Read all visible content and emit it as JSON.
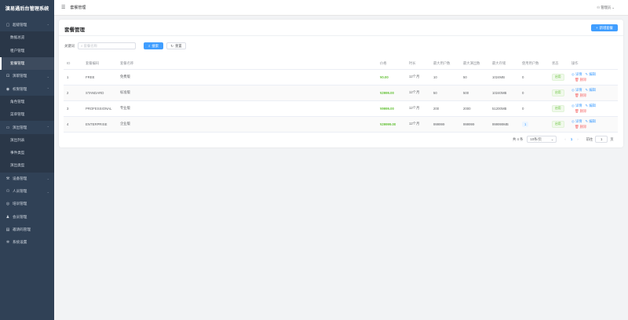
{
  "app_title": "演易通后台管理系统",
  "sidebar": {
    "items": [
      {
        "label": "超级管理",
        "icon": "monitor-icon",
        "expanded": true,
        "children": [
          "数据总览",
          "租户管理",
          "套餐管理"
        ]
      },
      {
        "label": "演职管理",
        "icon": "briefcase-icon",
        "expanded": false,
        "children": []
      },
      {
        "label": "权限管理",
        "icon": "lock-icon",
        "expanded": true,
        "children": [
          "角色管理",
          "菜单管理"
        ]
      },
      {
        "label": "演出管理",
        "icon": "screen-icon",
        "expanded": true,
        "children": [
          "演出列表",
          "事件类型",
          "演出类型"
        ]
      },
      {
        "label": "设备管理",
        "icon": "wrench-icon",
        "expanded": false,
        "children": []
      },
      {
        "label": "人员管理",
        "icon": "users-icon",
        "expanded": false,
        "children": []
      },
      {
        "label": "培训管理",
        "icon": "circle-icon",
        "expanded": false,
        "children": []
      },
      {
        "label": "会员管理",
        "icon": "user-icon",
        "expanded": false,
        "children": []
      },
      {
        "label": "邀请码管理",
        "icon": "document-icon",
        "expanded": false,
        "children": []
      },
      {
        "label": "系统设置",
        "icon": "gear-icon",
        "expanded": false,
        "children": []
      }
    ],
    "active": "套餐管理"
  },
  "header": {
    "breadcrumb": "套餐管理",
    "user": "管理员"
  },
  "card": {
    "title": "套餐管理",
    "new_button": "新增套餐",
    "keyword_label": "关键词",
    "search_placeholder": "套餐名称",
    "search_button": "搜索",
    "reset_button": "重置"
  },
  "table": {
    "columns": [
      "ID",
      "套餐编码",
      "套餐名称",
      "价格",
      "时长",
      "最大用户数",
      "最大演出数",
      "最大存储",
      "使用用户数",
      "状态",
      "操作"
    ],
    "rows": [
      {
        "id": "1",
        "code": "FREE",
        "name": "免费版",
        "price": "¥0.00",
        "duration": "12个月",
        "max_users": "10",
        "max_shows": "50",
        "storage": "1024MB",
        "used": "0",
        "status": "启用"
      },
      {
        "id": "2",
        "code": "STANDARD",
        "name": "标准版",
        "price": "¥2999.00",
        "duration": "12个月",
        "max_users": "50",
        "max_shows": "500",
        "storage": "10240MB",
        "used": "0",
        "status": "启用"
      },
      {
        "id": "3",
        "code": "PROFESSIONAL",
        "name": "专业版",
        "price": "¥9999.00",
        "duration": "12个月",
        "max_users": "200",
        "max_shows": "2000",
        "storage": "51200MB",
        "used": "0",
        "status": "启用"
      },
      {
        "id": "4",
        "code": "ENTERPRISE",
        "name": "企业版",
        "price": "¥29999.00",
        "duration": "12个月",
        "max_users": "999999",
        "max_shows": "999999",
        "storage": "999999MB",
        "used": "1",
        "status": "启用"
      }
    ],
    "actions": {
      "detail": "详情",
      "edit": "编辑",
      "delete": "删除"
    }
  },
  "pagination": {
    "total": "共 4 条",
    "page_size": "10条/页",
    "current": "1",
    "goto_label": "前往",
    "goto_value": "1",
    "page_suffix": "页"
  }
}
